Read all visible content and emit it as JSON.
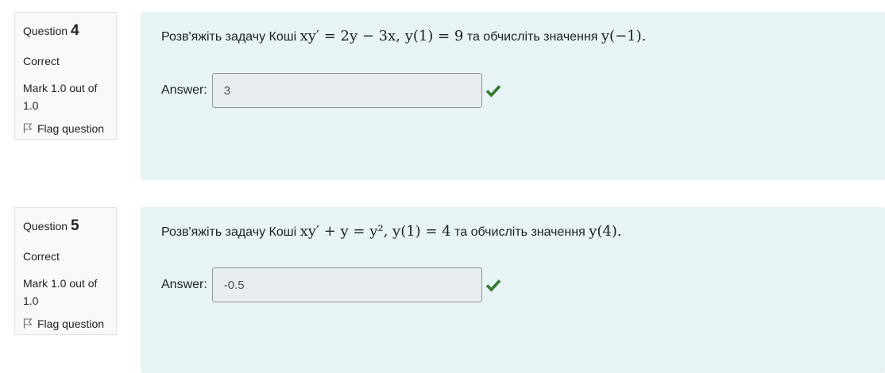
{
  "questions": [
    {
      "label": "Question",
      "number": "4",
      "state": "Correct",
      "grade": "Mark 1.0 out of 1.0",
      "flag": "Flag question",
      "text_prefix": "Розв'яжіть задачу Коші",
      "equation": "xy′ = 2y − 3x,   y(1) = 9",
      "text_mid": "та обчисліть значення",
      "target": "y(−1).",
      "answer_label": "Answer:",
      "answer_value": "3"
    },
    {
      "label": "Question",
      "number": "5",
      "state": "Correct",
      "grade": "Mark 1.0 out of 1.0",
      "flag": "Flag question",
      "text_prefix": "Розв'яжіть задачу Коші",
      "equation": "xy′ + y = y²,   y(1) = 4",
      "text_mid": "та обчисліть значення",
      "target": "y(4).",
      "answer_label": "Answer:",
      "answer_value": "-0.5"
    }
  ],
  "colors": {
    "correct_check": "#357a32",
    "content_bg": "#e7f3f5",
    "info_bg": "#f8f9fa"
  },
  "icons": {
    "flag": "flag-icon",
    "correct": "check-icon"
  }
}
